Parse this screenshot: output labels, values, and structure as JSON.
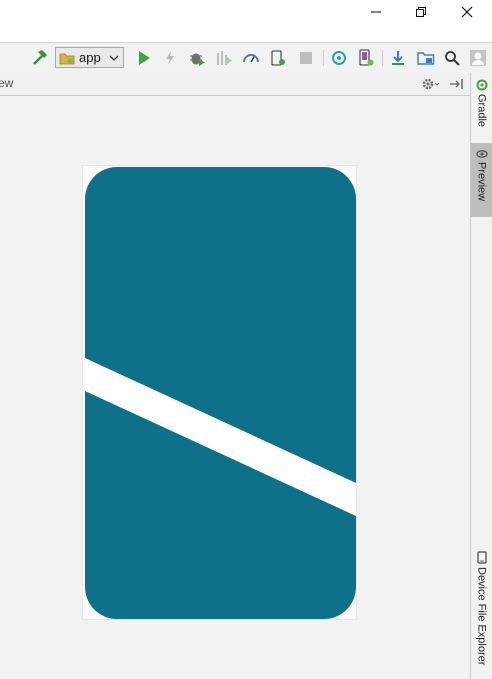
{
  "toolbar": {
    "run_config": {
      "label": "app"
    }
  },
  "preview": {
    "header_title": "ew"
  },
  "side_tabs": [
    {
      "label": "Gradle",
      "active": false
    },
    {
      "label": "Preview",
      "active": true
    },
    {
      "label": "Device File Explorer",
      "active": false
    }
  ],
  "colors": {
    "drawable_fill": "#0F7189",
    "stripe": "#FFFFFF",
    "run_green": "#3fa43a"
  }
}
